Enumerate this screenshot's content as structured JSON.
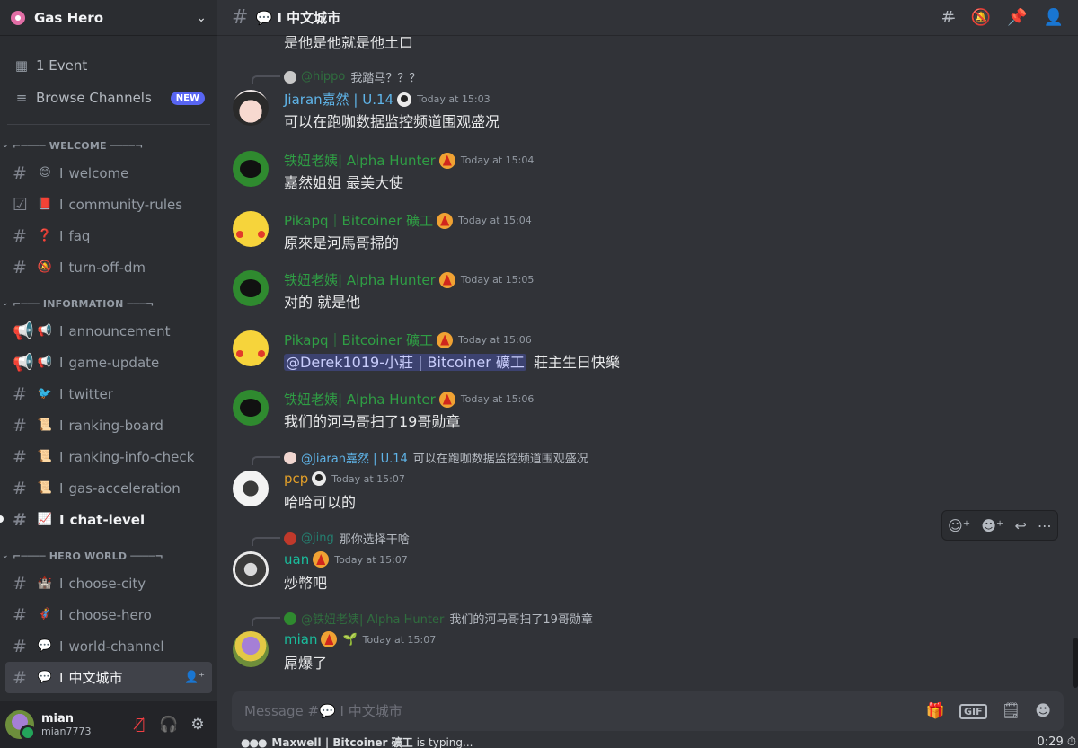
{
  "server": {
    "name": "Gas Hero"
  },
  "sidebar_top": [
    {
      "icon": "calendar-icon",
      "label": "1 Event"
    },
    {
      "icon": "browse-channels-icon",
      "label": "Browse Channels",
      "badge": "NEW"
    }
  ],
  "categories": {
    "welcome": "WELCOME",
    "information": "INFORMATION",
    "hero_world": "HERO WORLD"
  },
  "channels": {
    "welcome": "welcome",
    "community_rules": "community-rules",
    "faq": "faq",
    "turn_off_dm": "turn-off-dm",
    "announcement": "announcement",
    "game_update": "game-update",
    "twitter": "twitter",
    "ranking_board": "ranking-board",
    "ranking_info_check": "ranking-info-check",
    "gas_acceleration": "gas-acceleration",
    "chat_level": "chat-level",
    "choose_city": "choose-city",
    "choose_hero": "choose-hero",
    "world_channel": "world-channel",
    "cn_city": "中文城市"
  },
  "separator": "I",
  "user": {
    "name": "mian",
    "tag": "mian7773"
  },
  "header": {
    "channel": "I 中文城市"
  },
  "messages": {
    "top_fragment": "是他是他就是他土口",
    "m1": {
      "reply_who": "@hippo",
      "reply_text": "我踏马？？？",
      "author": "Jiaran嘉然 | U.14",
      "time": "Today at 15:03",
      "text": "可以在跑咖数据监控频道围观盛况"
    },
    "m2": {
      "author": "铁妞老姨| Alpha Hunter",
      "time": "Today at 15:04",
      "text": "嘉然姐姐 最美大使"
    },
    "m3": {
      "author": "Pikapq｜Bitcoiner 礦工",
      "time": "Today at 15:04",
      "text": "原來是河馬哥掃的"
    },
    "m4": {
      "author": "铁妞老姨| Alpha Hunter",
      "time": "Today at 15:05",
      "text": "对的 就是他"
    },
    "m5": {
      "author": "Pikapq｜Bitcoiner 礦工",
      "time": "Today at 15:06",
      "mention": "@Derek1019-小莊 | Bitcoiner 礦工",
      "text": "莊主生日快樂"
    },
    "m6": {
      "author": "铁妞老姨| Alpha Hunter",
      "time": "Today at 15:06",
      "text": "我们的河马哥扫了19哥勋章"
    },
    "m7": {
      "reply_who": "@Jiaran嘉然 | U.14",
      "reply_text": "可以在跑咖数据监控频道围观盛况",
      "author": "pcp",
      "time": "Today at 15:07",
      "text": "哈哈可以的"
    },
    "m8": {
      "reply_who": "@jing",
      "reply_text": "那你选择干啥",
      "author": "uan",
      "time": "Today at 15:07",
      "text": "炒幣吧"
    },
    "m9": {
      "reply_who": "@铁妞老姨| Alpha Hunter",
      "reply_text": "我们的河马哥扫了19哥勋章",
      "author": "mian",
      "time": "Today at 15:07",
      "text": "屌爆了"
    }
  },
  "composer": {
    "placeholder": "Message #💬 I 中文城市"
  },
  "typing": {
    "who": "Maxwell | Bitcoiner 礦工",
    "suffix": "is typing...",
    "timer": "0:29"
  }
}
